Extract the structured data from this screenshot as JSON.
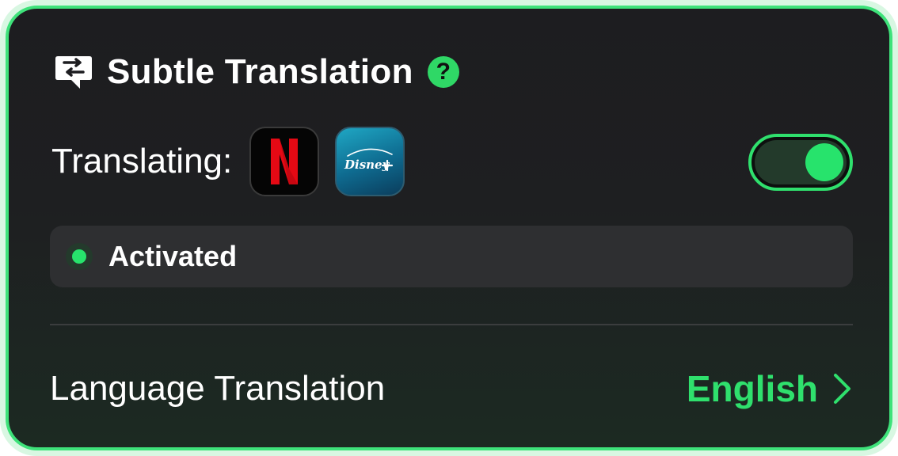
{
  "header": {
    "title": "Subtle Translation",
    "help_icon": "question-mark-icon",
    "help_glyph": "?"
  },
  "translating": {
    "label": "Translating:",
    "services": [
      {
        "name": "Netflix",
        "icon": "netflix-icon"
      },
      {
        "name": "Disney+",
        "icon": "disney-plus-icon"
      }
    ],
    "enabled": true
  },
  "status": {
    "text": "Activated"
  },
  "language": {
    "label": "Language Translation",
    "value": "English",
    "chevron_icon": "chevron-right-icon"
  },
  "colors": {
    "accent": "#2fe06d",
    "background": "#1d1d20",
    "status_bar": "#2e2f31"
  }
}
